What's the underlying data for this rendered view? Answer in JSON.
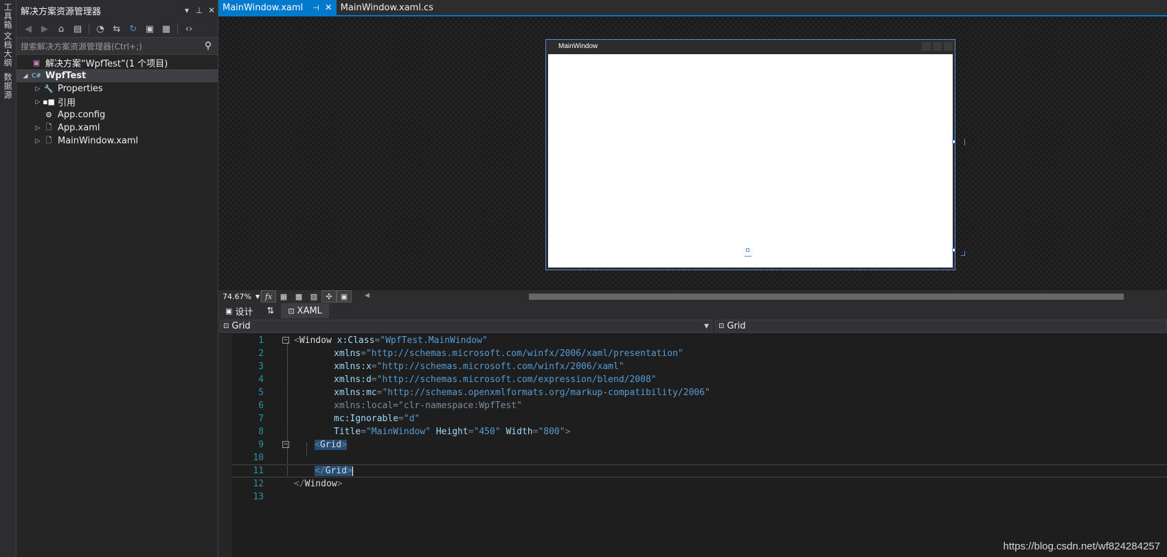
{
  "side_strip": {
    "items": [
      "工具箱",
      "文档大纲",
      "数据源"
    ]
  },
  "solution_explorer": {
    "title": "解决方案资源管理器",
    "title_icons": [
      "dropdown-icon",
      "pin-icon",
      "close-icon"
    ],
    "search_placeholder": "搜索解决方案资源管理器(Ctrl+;)",
    "tree": {
      "solution": "解决方案“WpfTest”(1 个项目)",
      "project": "WpfTest",
      "items": [
        "Properties",
        "引用",
        "App.config",
        "App.xaml",
        "MainWindow.xaml"
      ]
    }
  },
  "document_tabs": [
    {
      "label": "MainWindow.xaml",
      "active": true
    },
    {
      "label": "MainWindow.xaml.cs",
      "active": false
    }
  ],
  "designer": {
    "window_title": "MainWindow",
    "zoom": "74.67%",
    "fx_label": "fx"
  },
  "split_tabs": {
    "design": "设计",
    "swap": "⇅",
    "xaml": "XAML"
  },
  "navigation": {
    "left": "Grid",
    "right": "Grid"
  },
  "code_lines": [
    "1",
    "2",
    "3",
    "4",
    "5",
    "6",
    "7",
    "8",
    "9",
    "10",
    "11",
    "12",
    "13"
  ],
  "code": {
    "l1_tag": "Window",
    "l1_attr": "x:Class",
    "l1_val": "\"WpfTest.MainWindow\"",
    "l2_attr": "xmlns",
    "l2_val": "\"http://schemas.microsoft.com/winfx/2006/xaml/presentation\"",
    "l3_attr": "xmlns:x",
    "l3_val": "\"http://schemas.microsoft.com/winfx/2006/xaml\"",
    "l4_attr": "xmlns:d",
    "l4_val": "\"http://schemas.microsoft.com/expression/blend/2008\"",
    "l5_attr": "xmlns:mc",
    "l5_val": "\"http://schemas.openxmlformats.org/markup-compatibility/2006\"",
    "l6_attr": "xmlns:local",
    "l6_val": "\"clr-namespace:WpfTest\"",
    "l7_attr": "mc:Ignorable",
    "l7_val": "\"d\"",
    "l8_attr1": "Title",
    "l8_val1": "\"MainWindow\"",
    "l8_attr2": "Height",
    "l8_val2": "\"450\"",
    "l8_attr3": "Width",
    "l8_val3": "\"800\"",
    "grid_tag": "Grid",
    "window_tag": "Window"
  },
  "watermark": "https://blog.csdn.net/wf824284257"
}
